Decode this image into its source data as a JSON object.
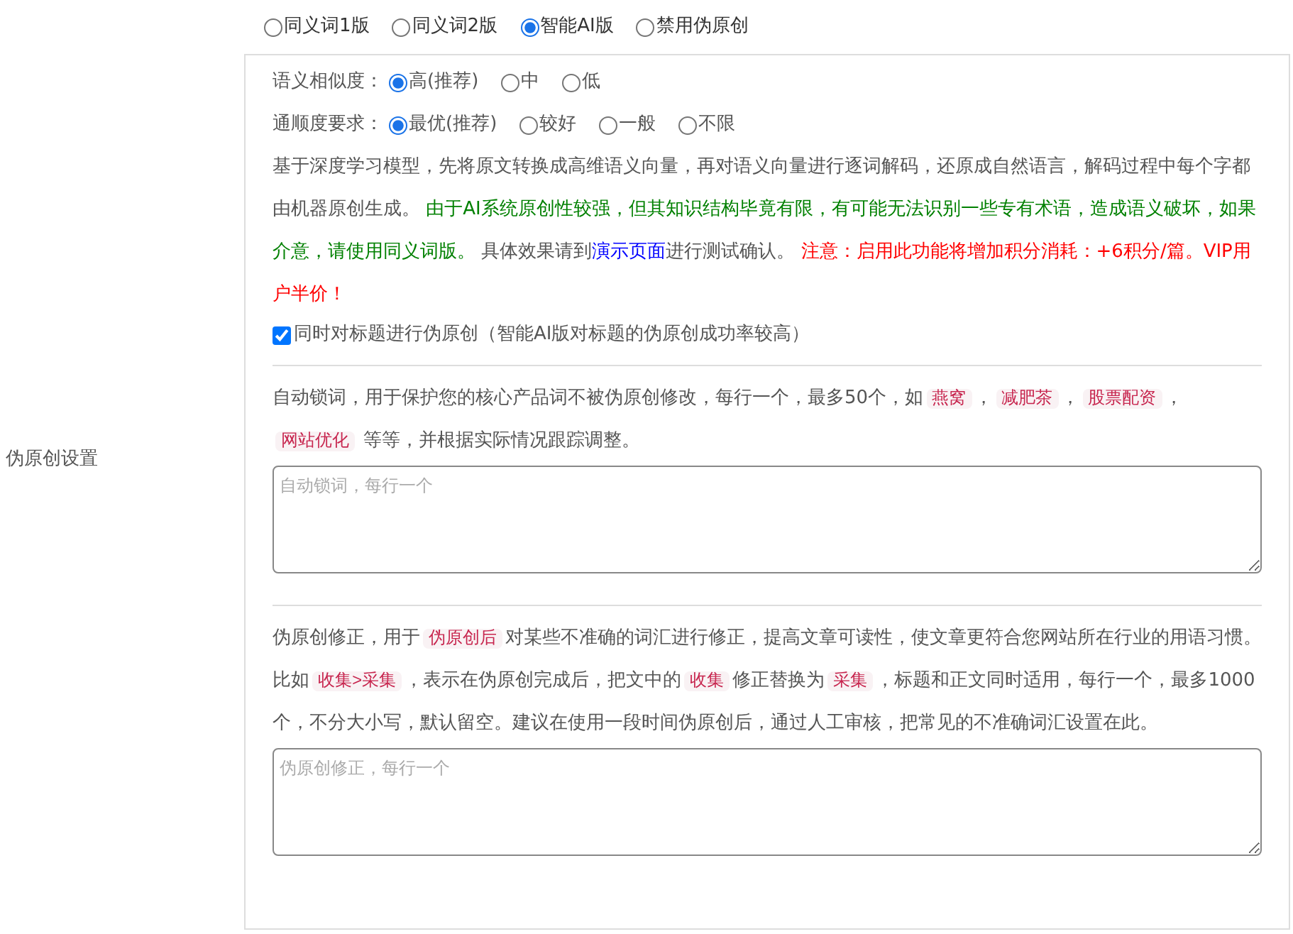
{
  "mode_options": [
    {
      "label": "同义词1版",
      "selected": false
    },
    {
      "label": "同义词2版",
      "selected": false
    },
    {
      "label": "智能AI版",
      "selected": true
    },
    {
      "label": "禁用伪原创",
      "selected": false
    }
  ],
  "ai_settings": {
    "similarity": {
      "label": "语义相似度：",
      "options": [
        {
          "label": "高(推荐)",
          "selected": true
        },
        {
          "label": "中",
          "selected": false
        },
        {
          "label": "低",
          "selected": false
        }
      ]
    },
    "fluency": {
      "label": "通顺度要求：",
      "options": [
        {
          "label": "最优(推荐)",
          "selected": true
        },
        {
          "label": "较好",
          "selected": false
        },
        {
          "label": "一般",
          "selected": false
        },
        {
          "label": "不限",
          "selected": false
        }
      ]
    },
    "description": [
      {
        "kind": "plain",
        "text": "基于深度学习模型，先将原文转换成高维语义向量，再对语义向量进行逐词解码，还原成自然语言，解码过程中每个字都由机器原创生成。 "
      },
      {
        "kind": "green",
        "text": "由于AI系统原创性较强，但其知识结构毕竟有限，有可能无法识别一些专有术语，造成语义破坏，如果介意，请使用同义词版。"
      },
      {
        "kind": "plain",
        "text": " 具体效果请到"
      },
      {
        "kind": "link",
        "text": "演示页面"
      },
      {
        "kind": "plain",
        "text": "进行测试确认。 "
      },
      {
        "kind": "red",
        "text": "注意：启用此功能将增加积分消耗：+6积分/篇。VIP用户半价！"
      }
    ],
    "title_option": {
      "label": "同时对标题进行伪原创（智能AI版对标题的伪原创成功率较高）",
      "checked": true
    }
  },
  "lock_words": {
    "side_label": "伪原创设置",
    "description": [
      {
        "kind": "plain",
        "text": "自动锁词，用于保护您的核心产品词不被伪原创修改，每行一个，最多50个，如"
      },
      {
        "kind": "tag",
        "text": "燕窝"
      },
      {
        "kind": "plain",
        "text": "，"
      },
      {
        "kind": "tag",
        "text": "减肥茶"
      },
      {
        "kind": "plain",
        "text": "，"
      },
      {
        "kind": "tag",
        "text": "股票配资"
      },
      {
        "kind": "plain",
        "text": "，"
      },
      {
        "kind": "tag",
        "text": "网站优化"
      },
      {
        "kind": "plain",
        "text": " 等等，并根据实际情况跟踪调整。"
      }
    ],
    "placeholder": "自动锁词，每行一个"
  },
  "correction": {
    "description": [
      {
        "kind": "plain",
        "text": "伪原创修正，用于"
      },
      {
        "kind": "tag",
        "text": "伪原创后"
      },
      {
        "kind": "plain",
        "text": "对某些不准确的词汇进行修正，提高文章可读性，使文章更符合您网站所在行业的用语习惯。比如"
      },
      {
        "kind": "tag",
        "text": "收集>采集"
      },
      {
        "kind": "plain",
        "text": "，表示在伪原创完成后，把文中的"
      },
      {
        "kind": "tag",
        "text": "收集"
      },
      {
        "kind": "plain",
        "text": "修正替换为"
      },
      {
        "kind": "tag",
        "text": "采集"
      },
      {
        "kind": "plain",
        "text": "，标题和正文同时适用，每行一个，最多1000个，不分大小写，默认留空。建议在使用一段时间伪原创后，通过人工审核，把常见的不准确词汇设置在此。"
      }
    ],
    "placeholder": "伪原创修正，每行一个"
  }
}
